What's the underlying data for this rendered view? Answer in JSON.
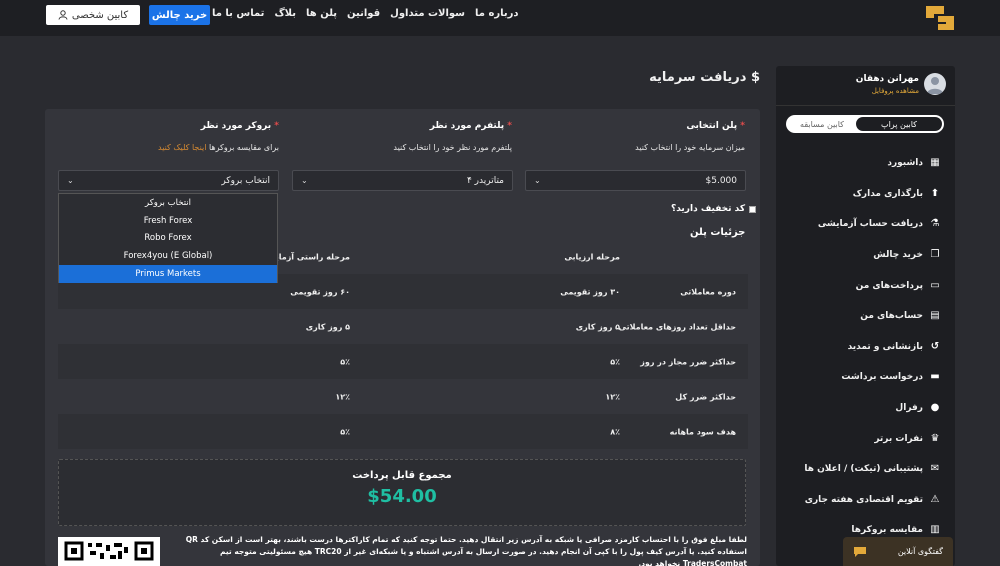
{
  "nav": {
    "links": [
      "درباره ما",
      "سوالات متداول",
      "قوانین",
      "پلن ها",
      "بلاگ",
      "تماس با ما"
    ],
    "buy_label": "خرید چالش",
    "cabinet_label": "کابین شخصی"
  },
  "page": {
    "title": "$ دریافت سرمایه"
  },
  "sidebar": {
    "user_name": "مهرانن دهقان",
    "profile_link": "مشاهده پروفایل",
    "toggle_on": "کابین پراپ",
    "toggle_off": "کابین مسابقه",
    "items": [
      {
        "label": "داشبورد",
        "icon": "dashboard-icon"
      },
      {
        "label": "بارگذاری مدارک",
        "icon": "upload-icon"
      },
      {
        "label": "دریافت حساب آزمایشی",
        "icon": "flask-icon"
      },
      {
        "label": "خرید چالش",
        "icon": "copy-icon"
      },
      {
        "label": "پرداخت‌های من",
        "icon": "money-icon"
      },
      {
        "label": "حساب‌های من",
        "icon": "chart-icon"
      },
      {
        "label": "بازنشانی و تمدید",
        "icon": "history-icon"
      },
      {
        "label": "درخواست برداشت",
        "icon": "wallet-icon"
      },
      {
        "label": "رفرال",
        "icon": "users-icon"
      },
      {
        "label": "نفرات برتر",
        "icon": "trophy-icon"
      },
      {
        "label": "پشتیبانی (تیکت) / اعلان ها",
        "icon": "chat-icon"
      },
      {
        "label": "تقویم اقتصادی هفته جاری",
        "icon": "warning-icon"
      },
      {
        "label": "مقایسه بروکرها",
        "icon": "book-icon"
      }
    ]
  },
  "form": {
    "plan_label": "پلن انتخابی",
    "plan_sub": "میزان سرمایه خود را انتخاب کنید",
    "plan_value": "$5.000",
    "platform_label": "پلتفرم مورد نظر",
    "platform_sub": "پلتفرم مورد نظر خود را انتخاب کنید",
    "platform_value": "متاتریدر ۴",
    "broker_label": "بروکر مورد نظر",
    "broker_sub": "برای مقایسه بروکرها",
    "broker_link": "اینجا کلیک کنید",
    "broker_value": "انتخاب بروکر",
    "discount_label": "کد تخفیف دارید؟",
    "details_title": "جزئیات پلن"
  },
  "broker_options": [
    "انتخاب بروکر",
    "Fresh Forex",
    "Robo Forex",
    "Forex4you (E Global)",
    "Primus Markets"
  ],
  "plan_table": {
    "header": [
      "",
      "مرحله ارزیابی",
      "مرحله راستی آزمایی"
    ],
    "rows": [
      [
        "دوره معاملاتی",
        "۳۰ روز تقویمی",
        "۶۰ روز تقویمی"
      ],
      [
        "حداقل تعداد روزهای معاملاتی",
        "۵ روز کاری",
        "۵ روز کاری"
      ],
      [
        "حداکثر ضرر مجاز در روز",
        "۵٪",
        "۵٪"
      ],
      [
        "حداکثر ضرر کل",
        "۱۲٪",
        "۱۲٪"
      ],
      [
        "هدف سود ماهانه",
        "۸٪",
        "۵٪"
      ]
    ]
  },
  "total": {
    "label": "مجموع قابل پرداخت",
    "value": "$54.00"
  },
  "note": "لطفا مبلغ فوق را با احتساب کارمزد صرافی یا شبکه به آدرس زیر انتقال دهید. حتما توجه کنید که تمام کاراکترها درست باشند، بهتر است از اسکن کد QR استفاده کنید. یا آدرس کیف پول را با کپی آن انجام دهید. در صورت ارسال به آدرس اشتباه و یا شبکه‌ای غیر از TRC20 هیچ مسئولیتی متوجه تیم TradersCombat نخواهد بود.",
  "chat": {
    "label": "گفتگوی آنلاین"
  },
  "colors": {
    "accent": "#1b73e8",
    "total": "#1fbfa3",
    "link": "#d58a32",
    "required": "#e24b4b"
  }
}
